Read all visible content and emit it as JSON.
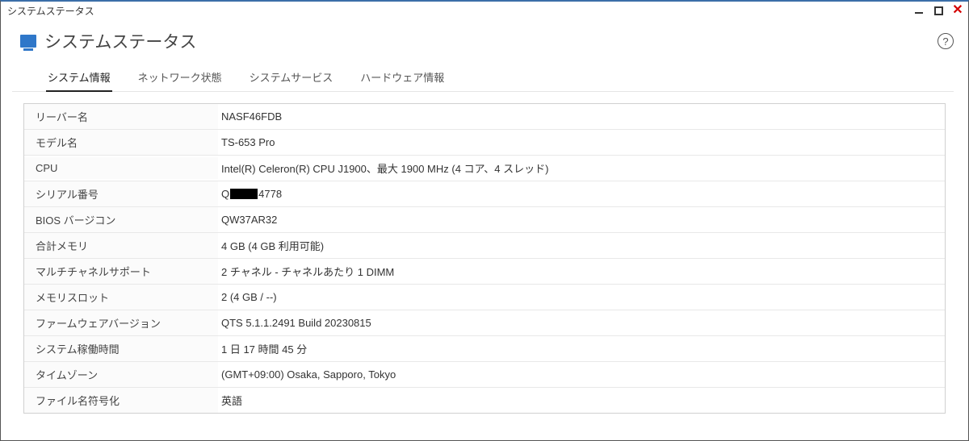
{
  "window": {
    "title": "システムステータス"
  },
  "header": {
    "title": "システムステータス"
  },
  "tabs": {
    "system_info": "システム情報",
    "network_status": "ネットワーク状態",
    "system_service": "システムサービス",
    "hardware_info": "ハードウェア情報"
  },
  "rows": {
    "server_name": {
      "label": "リーバー名",
      "value": "NASF46FDB"
    },
    "model_name": {
      "label": "モデル名",
      "value": "TS-653 Pro"
    },
    "cpu": {
      "label": "CPU",
      "value": "Intel(R) Celeron(R) CPU J1900、最大 1900 MHz (4 コア、4 スレッド)"
    },
    "serial": {
      "label": "シリアル番号",
      "pre": "Q",
      "post": "4778"
    },
    "bios": {
      "label": "BIOS バージコン",
      "value": "QW37AR32"
    },
    "memory": {
      "label": "合計メモリ",
      "value": "4 GB (4 GB 利用可能)"
    },
    "multichannel": {
      "label": "マルチチャネルサポート",
      "value": "2 チャネル - チャネルあたり 1 DIMM"
    },
    "mem_slot": {
      "label": "メモリスロット",
      "value": "2 (4 GB / --)"
    },
    "firmware": {
      "label": "ファームウェアバージョン",
      "value": "QTS 5.1.1.2491 Build 20230815"
    },
    "uptime": {
      "label": "システム稼働時間",
      "value": "1 日 17 時間 45 分"
    },
    "timezone": {
      "label": "タイムゾーン",
      "value": "(GMT+09:00) Osaka, Sapporo, Tokyo"
    },
    "encoding": {
      "label": "ファイル名符号化",
      "value": "英語"
    }
  }
}
